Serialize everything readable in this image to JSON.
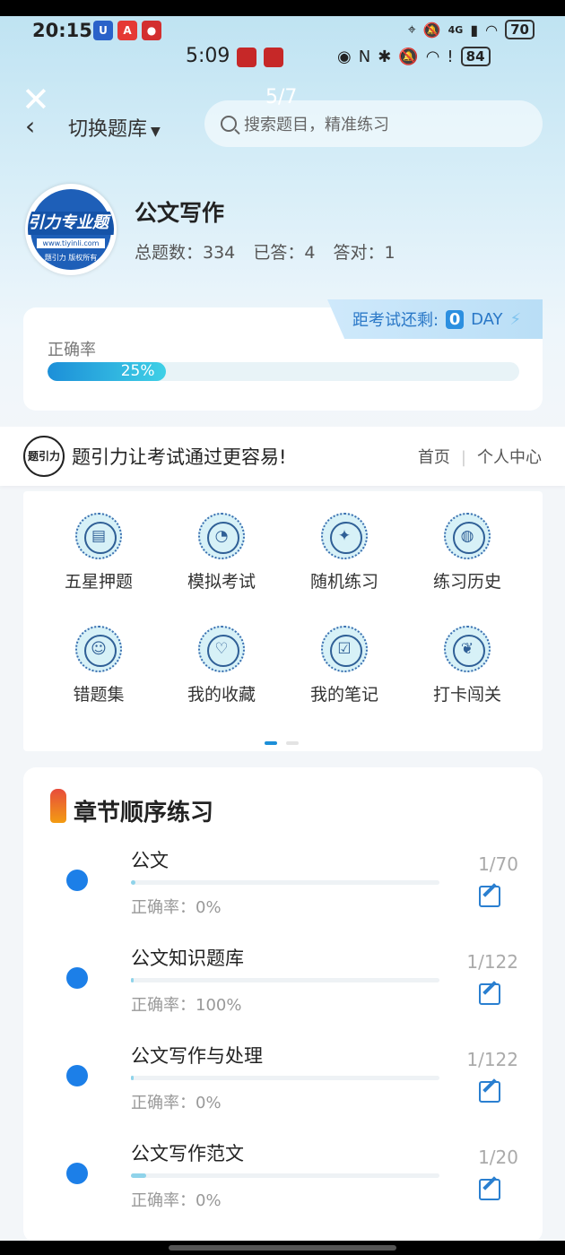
{
  "status_bar_1": {
    "time": "20:15",
    "battery": "70",
    "network": "4G"
  },
  "status_bar_2": {
    "time": "5:09",
    "battery": "84"
  },
  "viewer": {
    "counter": "5/7"
  },
  "header": {
    "switch_label": "切换题库",
    "search_placeholder": "搜索题目，精准练习"
  },
  "course": {
    "logo_text": "引力专业题",
    "logo_url": "www.tiyinli.com",
    "logo_sub": "题引力 版权所有",
    "title": "公文写作",
    "total_label": "总题数：334",
    "answered_label": "已答：4",
    "correct_label": "答对：1"
  },
  "exam": {
    "prefix": "距考试还剩:",
    "days": "0",
    "unit": "DAY"
  },
  "accuracy": {
    "label": "正确率",
    "value_text": "25%",
    "value": 0.25
  },
  "slogan": {
    "badge": "题引力",
    "text": "题引力让考试通过更容易!",
    "link_home": "首页",
    "link_profile": "个人中心"
  },
  "grid": [
    {
      "label": "五星押题",
      "icon": "id-card-icon"
    },
    {
      "label": "模拟考试",
      "icon": "gauge-icon"
    },
    {
      "label": "随机练习",
      "icon": "network-icon"
    },
    {
      "label": "练习历史",
      "icon": "globe-icon"
    },
    {
      "label": "错题集",
      "icon": "head-icon"
    },
    {
      "label": "我的收藏",
      "icon": "heart-icon"
    },
    {
      "label": "我的笔记",
      "icon": "note-check-icon"
    },
    {
      "label": "打卡闯关",
      "icon": "sprout-icon"
    }
  ],
  "chapters": {
    "title": "章节顺序练习",
    "items": [
      {
        "name": "公文",
        "accuracy": "正确率：0%",
        "count": "1/70",
        "progress": 0.014
      },
      {
        "name": "公文知识题库",
        "accuracy": "正确率：100%",
        "count": "1/122",
        "progress": 0.008
      },
      {
        "name": "公文写作与处理",
        "accuracy": "正确率：0%",
        "count": "1/122",
        "progress": 0.008
      },
      {
        "name": "公文写作范文",
        "accuracy": "正确率：0%",
        "count": "1/20",
        "progress": 0.05
      }
    ]
  }
}
